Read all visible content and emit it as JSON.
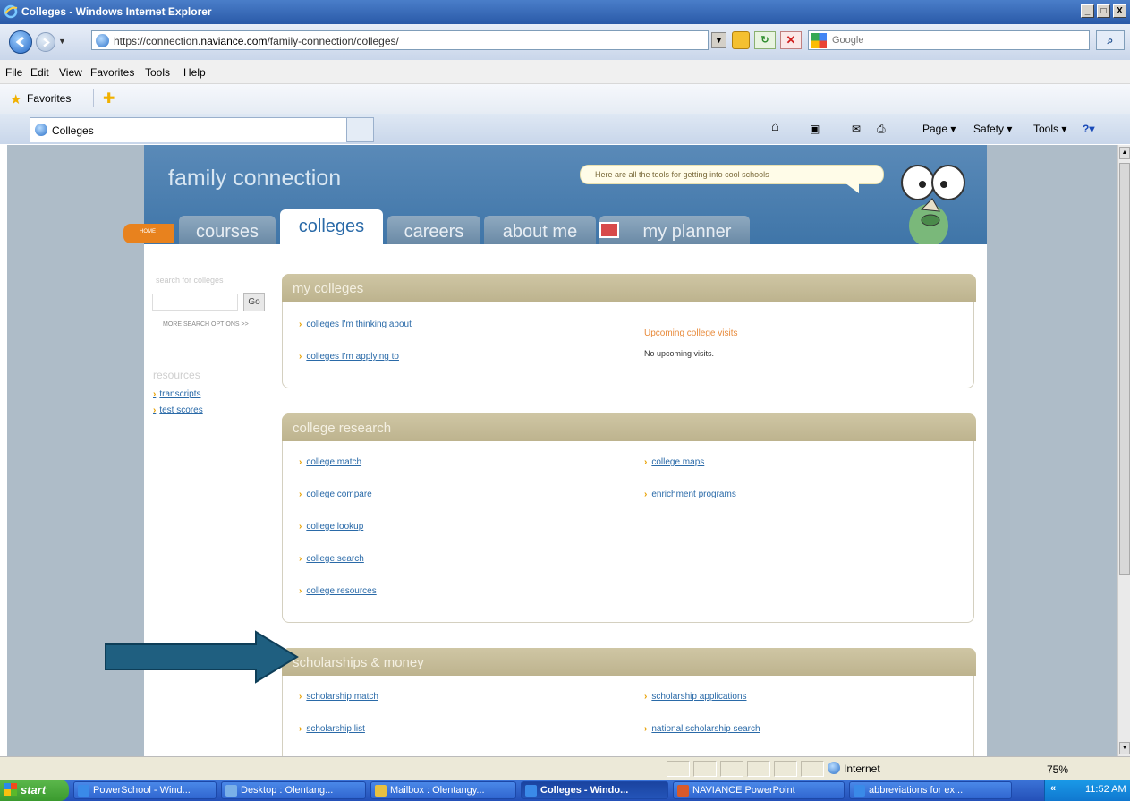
{
  "window": {
    "title": "Colleges - Windows Internet Explorer",
    "minimize": "_",
    "maximize": "□",
    "close": "X"
  },
  "address": {
    "url_prefix": "https://connection.",
    "url_domain": "naviance.com",
    "url_path": "/family-connection/colleges/",
    "search_placeholder": "Google"
  },
  "menu": [
    "File",
    "Edit",
    "View",
    "Favorites",
    "Tools",
    "Help"
  ],
  "favorites": {
    "label": "Favorites"
  },
  "tab": {
    "label": "Colleges"
  },
  "commandbar": {
    "page": "Page ▾",
    "safety": "Safety ▾",
    "tools": "Tools ▾"
  },
  "site": {
    "brand": "family connection",
    "bubble": "Here are all the tools for getting into cool schools",
    "home_badge": "HOME",
    "nav": [
      {
        "label": "courses",
        "active": false
      },
      {
        "label": "colleges",
        "active": true
      },
      {
        "label": "careers",
        "active": false
      },
      {
        "label": "about me",
        "active": false
      },
      {
        "label": "my planner",
        "active": false
      }
    ],
    "sidebar": {
      "search_label": "search for colleges",
      "go": "Go",
      "more_options": "MORE SEARCH OPTIONS >>",
      "resources_label": "resources",
      "resources": [
        "transcripts",
        "test scores"
      ]
    },
    "panels": {
      "my_colleges": {
        "title": "my colleges",
        "links": [
          "colleges I'm thinking about",
          "colleges I'm applying to"
        ],
        "visits_title": "Upcoming college visits",
        "visits_none": "No upcoming visits."
      },
      "research": {
        "title": "college research",
        "left": [
          "college match",
          "college compare",
          "college lookup",
          "college search",
          "college resources"
        ],
        "right": [
          "college maps",
          "enrichment programs"
        ]
      },
      "scholarships": {
        "title": "scholarships & money",
        "left": [
          "scholarship match",
          "scholarship list"
        ],
        "right": [
          "scholarship applications",
          "national scholarship search"
        ]
      }
    }
  },
  "status": {
    "zone": "Internet",
    "zoom": "75%"
  },
  "taskbar": {
    "start": "start",
    "items": [
      {
        "label": "PowerSchool - Wind...",
        "active": false
      },
      {
        "label": "Desktop : Olentang...",
        "active": false
      },
      {
        "label": "Mailbox : Olentangy...",
        "active": false
      },
      {
        "label": "Colleges - Windo...",
        "active": true
      },
      {
        "label": "NAVIANCE PowerPoint",
        "active": false
      },
      {
        "label": "abbreviations for ex...",
        "active": false
      }
    ],
    "clock": "11:52 AM"
  },
  "colors": {
    "header_blue": "#3f75a8",
    "panel_tan": "#bdb38e",
    "link_blue": "#2a6aa8",
    "chevron_orange": "#e8a000",
    "arrow_teal": "#1f5f80"
  }
}
